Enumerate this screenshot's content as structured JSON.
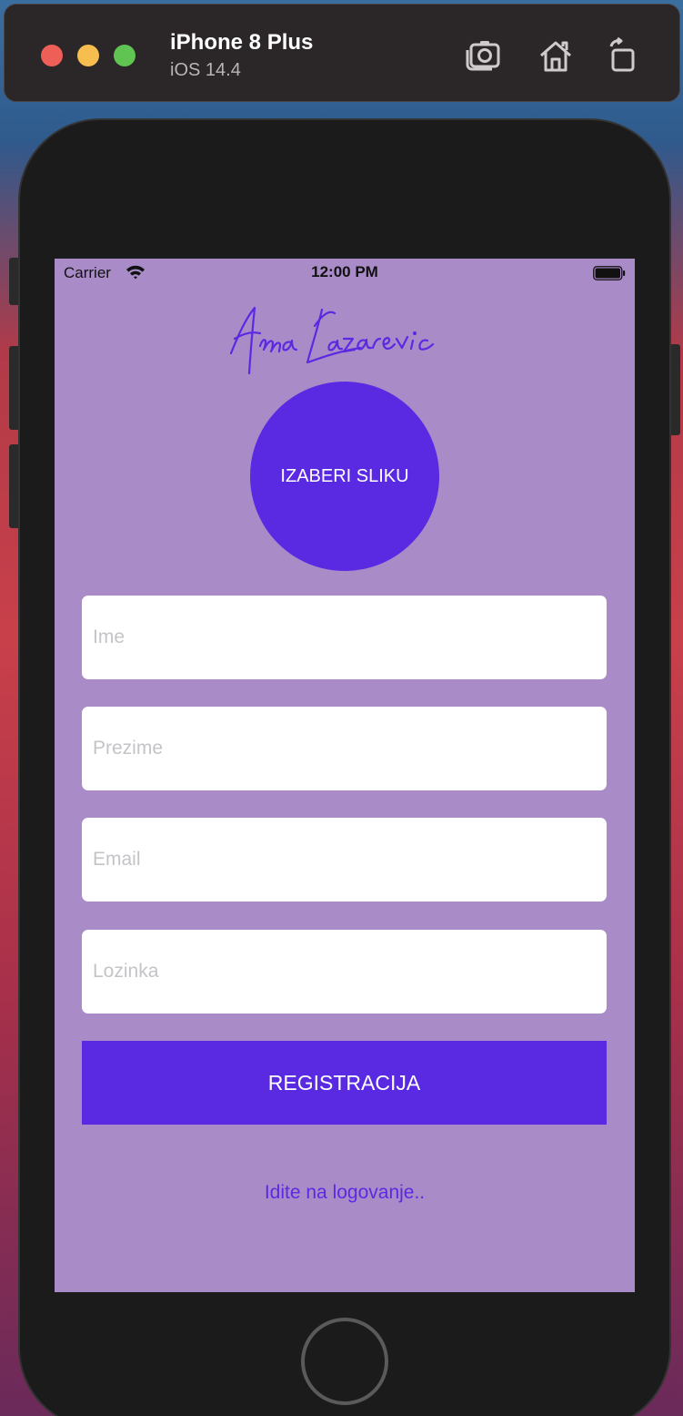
{
  "simulator": {
    "device_name": "iPhone 8 Plus",
    "os_version": "iOS 14.4",
    "toolbar_icons": [
      "screenshot-icon",
      "home-icon",
      "rotate-icon"
    ]
  },
  "status_bar": {
    "carrier": "Carrier",
    "time": "12:00 PM"
  },
  "app": {
    "signature_text": "Anna Lazarevic",
    "choose_image_label": "IZABERI SLIKU",
    "fields": [
      {
        "placeholder": "Ime",
        "value": ""
      },
      {
        "placeholder": "Prezime",
        "value": ""
      },
      {
        "placeholder": "Email",
        "value": ""
      },
      {
        "placeholder": "Lozinka",
        "value": ""
      }
    ],
    "register_label": "REGISTRACIJA",
    "login_link": "Idite na logovanje.."
  },
  "colors": {
    "screen_background": "#a98bc8",
    "accent": "#5a2ae3"
  }
}
